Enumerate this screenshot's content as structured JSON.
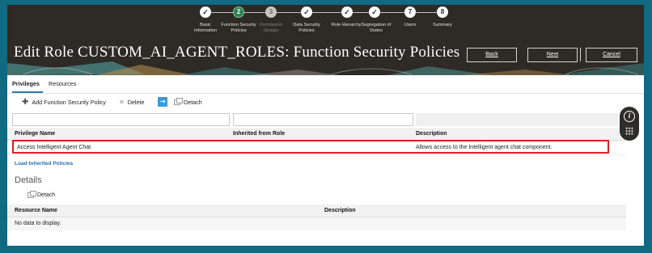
{
  "train": {
    "stops": [
      {
        "symbol": "✓",
        "label": "Basic Information",
        "state": "done"
      },
      {
        "symbol": "2",
        "label": "Function Security Policies",
        "state": "current"
      },
      {
        "symbol": "3",
        "label": "Permission Groups",
        "state": "disabled"
      },
      {
        "symbol": "✓",
        "label": "Data Security Policies",
        "state": "done"
      },
      {
        "symbol": "✓",
        "label": "Role Hierarchy",
        "state": "done"
      },
      {
        "symbol": "✓",
        "label": "Segregation of Duties",
        "state": "done"
      },
      {
        "symbol": "7",
        "label": "Users",
        "state": "pending"
      },
      {
        "symbol": "8",
        "label": "Summary",
        "state": "pending"
      }
    ]
  },
  "header": {
    "title": "Edit Role CUSTOM_AI_AGENT_ROLES: Function Security Policies",
    "back_label": "Back",
    "next_label": "Next",
    "cancel_label": "Cancel"
  },
  "tabs": {
    "privileges": "Privileges",
    "resources": "Resources"
  },
  "toolbar": {
    "add_label": "Add Function Security Policy",
    "delete_label": "Delete",
    "detach_label": "Detach"
  },
  "privileges_table": {
    "columns": {
      "name": "Privilege Name",
      "inherited": "Inherited from Role",
      "description": "Description"
    },
    "rows": [
      {
        "name": "Access Intelligent Agent Chat",
        "inherited": "",
        "description": "Allows access to the Intelligent agent chat component."
      }
    ]
  },
  "load_link": "Load Inherited Policies",
  "details": {
    "title": "Details",
    "detach_label": "Detach",
    "columns": {
      "resource": "Resource Name",
      "description": "Description"
    },
    "empty_text": "No data to display."
  },
  "icons": {
    "add": "plus-icon",
    "delete": "close-icon",
    "blue_action": "freeze-columns-icon",
    "detach": "detach-icon",
    "help": "info-icon",
    "help_grid": "grid-dots-icon"
  },
  "colors": {
    "frame": "#0f6a82",
    "banner": "#2e2a25",
    "current_step": "#2f7f4f",
    "highlight": "#e01f25",
    "link": "#2a6db0",
    "tab_underline": "#2d7ba4"
  }
}
